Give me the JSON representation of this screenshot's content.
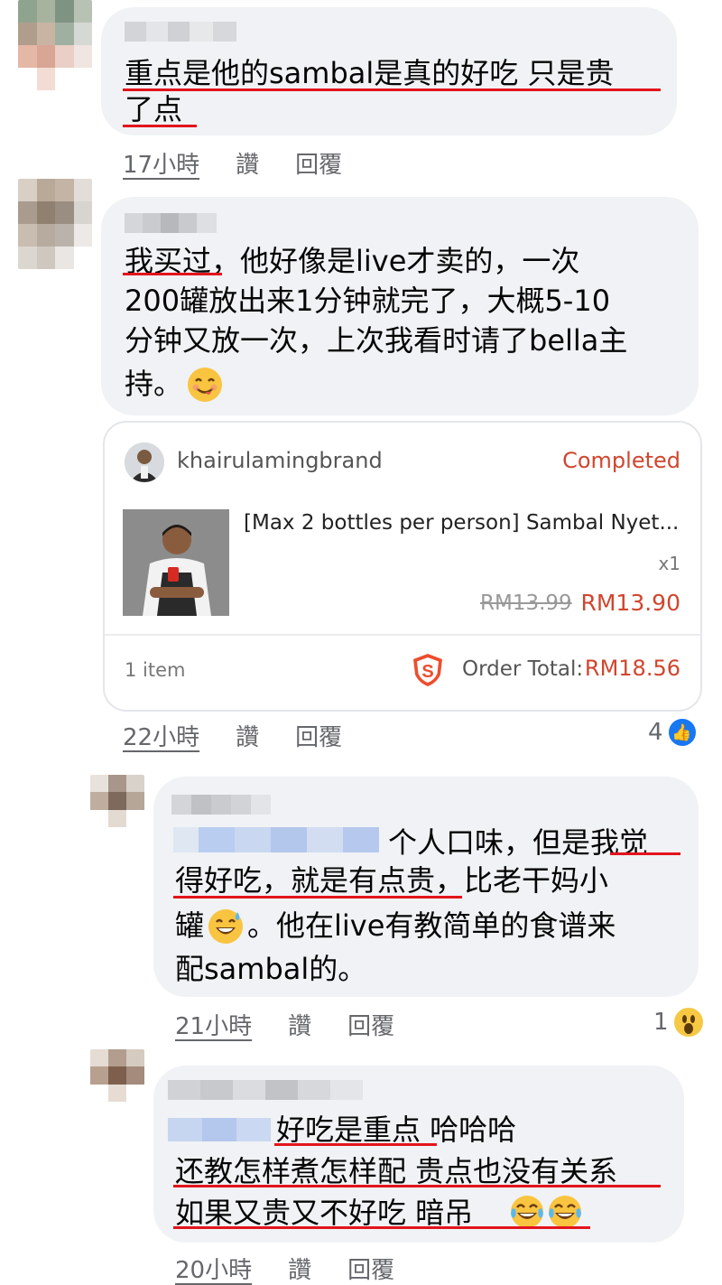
{
  "comments": [
    {
      "text_lines": [
        "重点是他的sambal是真的好吃 只是贵",
        "了点"
      ],
      "time": "17小時",
      "like_label": "讚",
      "reply_label": "回覆"
    },
    {
      "text_lines": [
        "我买过，他好像是live才卖的，一次",
        "200罐放出来1分钟就完了，大概5-10",
        "分钟又放一次，上次我看时请了bella主",
        "持。"
      ],
      "emoji": "smiling-face-icon",
      "time": "22小時",
      "like_label": "讚",
      "reply_label": "回覆",
      "reaction_count": "4",
      "reaction_type": "like"
    },
    {
      "text_lines": [
        "个人口味，但是我觉",
        "得好吃，就是有点贵，比老干妈小",
        "罐",
        "。他在live有教简单的食谱来",
        "配sambal的。"
      ],
      "emoji": "grinning-sweat-icon",
      "time": "21小時",
      "like_label": "讚",
      "reply_label": "回覆",
      "reaction_count": "1",
      "reaction_type": "wow"
    },
    {
      "text_lines": [
        "好吃是重点 哈哈哈",
        "还教怎样煮怎样配 贵点也没有关系",
        "如果又贵又不好吃 暗吊 "
      ],
      "emoji": "tears-of-joy-icon",
      "time": "20小時",
      "like_label": "讚",
      "reply_label": "回覆"
    }
  ],
  "order_card": {
    "shop_name": "khairulamingbrand",
    "status": "Completed",
    "product_title": "[Max 2 bottles per person] Sambal Nyet...",
    "quantity": "x1",
    "original_price": "RM13.99",
    "price": "RM13.90",
    "item_count": "1 item",
    "total_label": "Order Total:",
    "total_value": "RM18.56"
  },
  "colors": {
    "bubble": "#f0f2f5",
    "underline": "#e3141c",
    "accent": "#d0462e",
    "meta": "#65676b",
    "like_blue": "#1877f2"
  }
}
